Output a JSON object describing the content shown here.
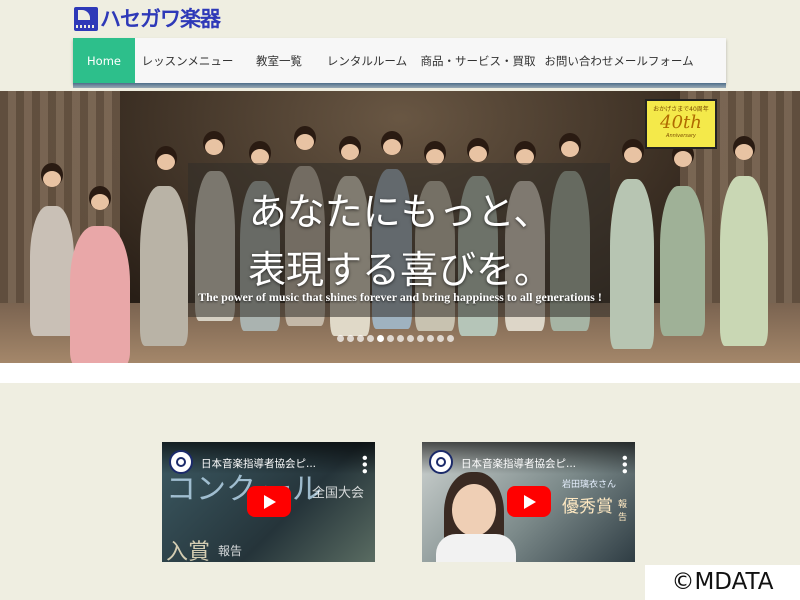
{
  "logo": {
    "text": "ハセガワ楽器"
  },
  "nav": {
    "items": [
      {
        "label": "Home",
        "active": true
      },
      {
        "label": "レッスンメニュー"
      },
      {
        "label": "教室一覧"
      },
      {
        "label": "レンタルルーム"
      },
      {
        "label": "商品・サービス・買取"
      },
      {
        "label": "お問い合わせメールフォーム"
      }
    ]
  },
  "hero": {
    "line1": "あなたにもっと、",
    "line2": "表現する喜びを。",
    "subtitle": "The power of music that shines forever and bring happiness to all generations !",
    "badge": {
      "top": "おかげさまで40周年",
      "big": "40th",
      "small": "Anniversary"
    },
    "slider_dots": 12,
    "active_dot": 4
  },
  "videos": [
    {
      "title": "日本音楽指導者協会ピ...",
      "overlay": [
        "コンク",
        "ール",
        "全国大会",
        "入賞",
        "報告"
      ]
    },
    {
      "title": "日本音楽指導者協会ピ...",
      "overlay": [
        "岩田璃衣さん",
        "優秀賞",
        "報告"
      ]
    }
  ],
  "watermark": "©MDATA",
  "colors": {
    "accent": "#2dbf8b",
    "logo": "#2e39b8",
    "page_bg": "#efeee1",
    "play": "#ff0000"
  }
}
